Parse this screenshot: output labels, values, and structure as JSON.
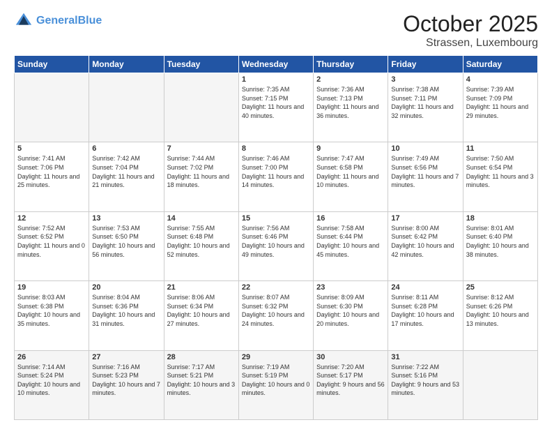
{
  "header": {
    "logo_line1": "General",
    "logo_line2": "Blue",
    "title": "October 2025",
    "subtitle": "Strassen, Luxembourg"
  },
  "calendar": {
    "days_of_week": [
      "Sunday",
      "Monday",
      "Tuesday",
      "Wednesday",
      "Thursday",
      "Friday",
      "Saturday"
    ],
    "weeks": [
      [
        {
          "day": "",
          "info": ""
        },
        {
          "day": "",
          "info": ""
        },
        {
          "day": "",
          "info": ""
        },
        {
          "day": "1",
          "info": "Sunrise: 7:35 AM\nSunset: 7:15 PM\nDaylight: 11 hours\nand 40 minutes."
        },
        {
          "day": "2",
          "info": "Sunrise: 7:36 AM\nSunset: 7:13 PM\nDaylight: 11 hours\nand 36 minutes."
        },
        {
          "day": "3",
          "info": "Sunrise: 7:38 AM\nSunset: 7:11 PM\nDaylight: 11 hours\nand 32 minutes."
        },
        {
          "day": "4",
          "info": "Sunrise: 7:39 AM\nSunset: 7:09 PM\nDaylight: 11 hours\nand 29 minutes."
        }
      ],
      [
        {
          "day": "5",
          "info": "Sunrise: 7:41 AM\nSunset: 7:06 PM\nDaylight: 11 hours\nand 25 minutes."
        },
        {
          "day": "6",
          "info": "Sunrise: 7:42 AM\nSunset: 7:04 PM\nDaylight: 11 hours\nand 21 minutes."
        },
        {
          "day": "7",
          "info": "Sunrise: 7:44 AM\nSunset: 7:02 PM\nDaylight: 11 hours\nand 18 minutes."
        },
        {
          "day": "8",
          "info": "Sunrise: 7:46 AM\nSunset: 7:00 PM\nDaylight: 11 hours\nand 14 minutes."
        },
        {
          "day": "9",
          "info": "Sunrise: 7:47 AM\nSunset: 6:58 PM\nDaylight: 11 hours\nand 10 minutes."
        },
        {
          "day": "10",
          "info": "Sunrise: 7:49 AM\nSunset: 6:56 PM\nDaylight: 11 hours\nand 7 minutes."
        },
        {
          "day": "11",
          "info": "Sunrise: 7:50 AM\nSunset: 6:54 PM\nDaylight: 11 hours\nand 3 minutes."
        }
      ],
      [
        {
          "day": "12",
          "info": "Sunrise: 7:52 AM\nSunset: 6:52 PM\nDaylight: 11 hours\nand 0 minutes."
        },
        {
          "day": "13",
          "info": "Sunrise: 7:53 AM\nSunset: 6:50 PM\nDaylight: 10 hours\nand 56 minutes."
        },
        {
          "day": "14",
          "info": "Sunrise: 7:55 AM\nSunset: 6:48 PM\nDaylight: 10 hours\nand 52 minutes."
        },
        {
          "day": "15",
          "info": "Sunrise: 7:56 AM\nSunset: 6:46 PM\nDaylight: 10 hours\nand 49 minutes."
        },
        {
          "day": "16",
          "info": "Sunrise: 7:58 AM\nSunset: 6:44 PM\nDaylight: 10 hours\nand 45 minutes."
        },
        {
          "day": "17",
          "info": "Sunrise: 8:00 AM\nSunset: 6:42 PM\nDaylight: 10 hours\nand 42 minutes."
        },
        {
          "day": "18",
          "info": "Sunrise: 8:01 AM\nSunset: 6:40 PM\nDaylight: 10 hours\nand 38 minutes."
        }
      ],
      [
        {
          "day": "19",
          "info": "Sunrise: 8:03 AM\nSunset: 6:38 PM\nDaylight: 10 hours\nand 35 minutes."
        },
        {
          "day": "20",
          "info": "Sunrise: 8:04 AM\nSunset: 6:36 PM\nDaylight: 10 hours\nand 31 minutes."
        },
        {
          "day": "21",
          "info": "Sunrise: 8:06 AM\nSunset: 6:34 PM\nDaylight: 10 hours\nand 27 minutes."
        },
        {
          "day": "22",
          "info": "Sunrise: 8:07 AM\nSunset: 6:32 PM\nDaylight: 10 hours\nand 24 minutes."
        },
        {
          "day": "23",
          "info": "Sunrise: 8:09 AM\nSunset: 6:30 PM\nDaylight: 10 hours\nand 20 minutes."
        },
        {
          "day": "24",
          "info": "Sunrise: 8:11 AM\nSunset: 6:28 PM\nDaylight: 10 hours\nand 17 minutes."
        },
        {
          "day": "25",
          "info": "Sunrise: 8:12 AM\nSunset: 6:26 PM\nDaylight: 10 hours\nand 13 minutes."
        }
      ],
      [
        {
          "day": "26",
          "info": "Sunrise: 7:14 AM\nSunset: 5:24 PM\nDaylight: 10 hours\nand 10 minutes."
        },
        {
          "day": "27",
          "info": "Sunrise: 7:16 AM\nSunset: 5:23 PM\nDaylight: 10 hours\nand 7 minutes."
        },
        {
          "day": "28",
          "info": "Sunrise: 7:17 AM\nSunset: 5:21 PM\nDaylight: 10 hours\nand 3 minutes."
        },
        {
          "day": "29",
          "info": "Sunrise: 7:19 AM\nSunset: 5:19 PM\nDaylight: 10 hours\nand 0 minutes."
        },
        {
          "day": "30",
          "info": "Sunrise: 7:20 AM\nSunset: 5:17 PM\nDaylight: 9 hours\nand 56 minutes."
        },
        {
          "day": "31",
          "info": "Sunrise: 7:22 AM\nSunset: 5:16 PM\nDaylight: 9 hours\nand 53 minutes."
        },
        {
          "day": "",
          "info": ""
        }
      ]
    ]
  }
}
